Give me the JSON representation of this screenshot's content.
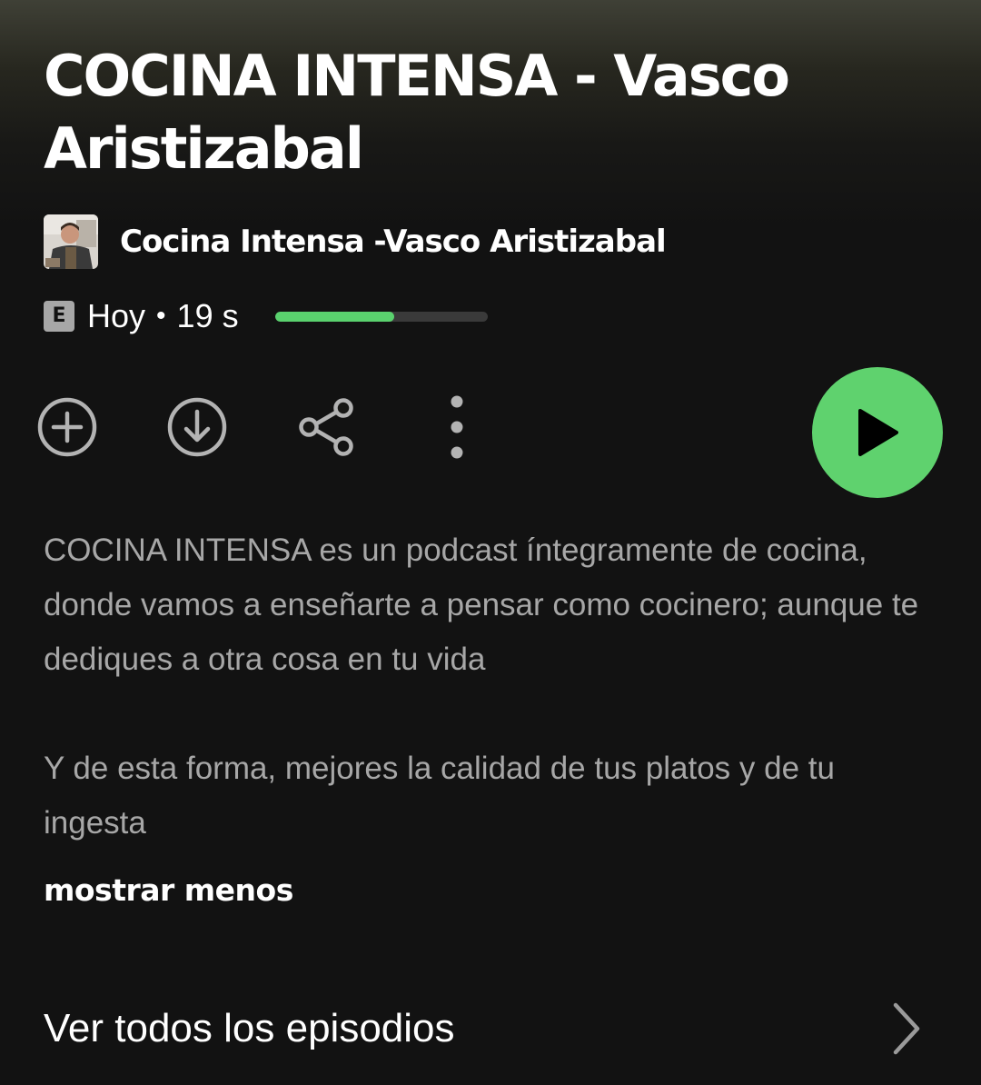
{
  "episode": {
    "title": "COCINA INTENSA - Vasco Aristizabal",
    "show_name": "Cocina Intensa -Vasco Aristizabal",
    "explicit_badge": "E",
    "date": "Hoy",
    "separator": "•",
    "duration": "19 s",
    "progress_fraction": 0.56
  },
  "actions": {
    "add_icon": "plus-circle-icon",
    "download_icon": "download-circle-icon",
    "share_icon": "share-icon",
    "more_icon": "more-vertical-icon",
    "play_icon": "play-icon"
  },
  "description": {
    "paragraphs": [
      "COCINA INTENSA es un podcast íntegramente de cocina, donde vamos a enseñarte a pensar como cocinero; aunque te dediques a otra cosa en tu vida",
      "Y de esta forma, mejores la calidad de tus platos y de tu ingesta"
    ],
    "toggle_label": "mostrar menos"
  },
  "footer": {
    "all_episodes_label": "Ver todos los episodios"
  },
  "colors": {
    "accent": "#5fd26e",
    "background": "#121212",
    "secondary_text": "#a7a7a7",
    "icon_gray": "#b3b3b3"
  }
}
